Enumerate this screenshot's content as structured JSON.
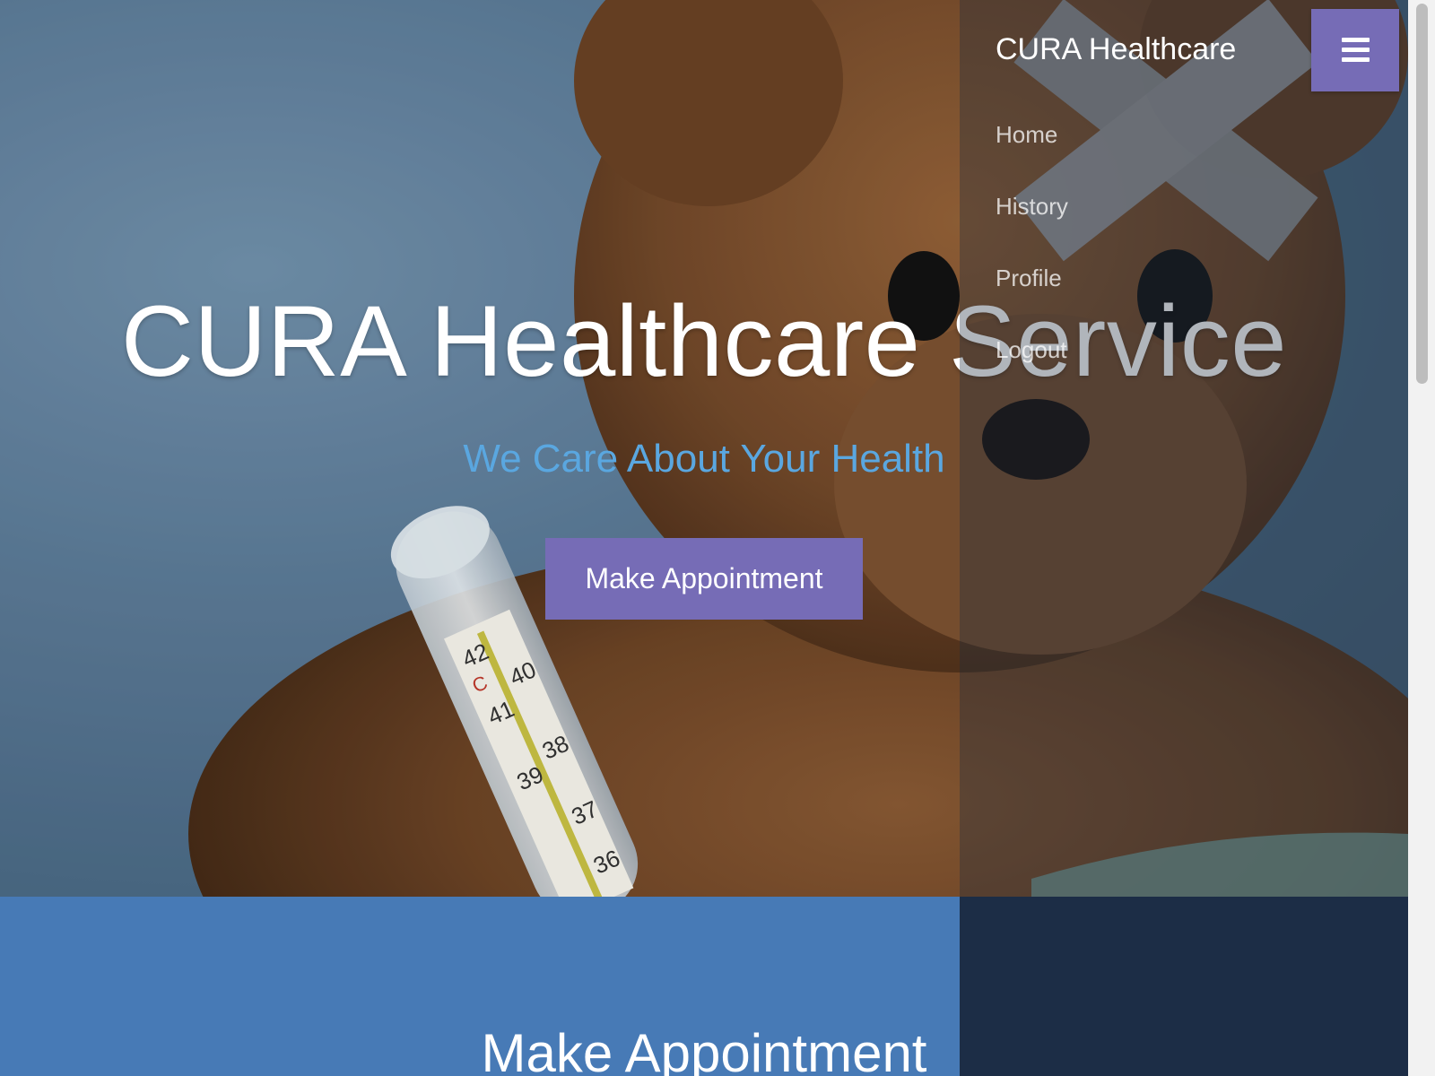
{
  "hero": {
    "title": "CURA Healthcare Service",
    "subtitle": "We Care About Your Health",
    "cta_label": "Make Appointment"
  },
  "appointment": {
    "title": "Make Appointment"
  },
  "sidebar": {
    "brand": "CURA Healthcare",
    "items": [
      {
        "label": "Home"
      },
      {
        "label": "History"
      },
      {
        "label": "Profile"
      },
      {
        "label": "Logout"
      }
    ],
    "toggle_icon": "hamburger-menu-icon"
  },
  "thermometer": {
    "scale_labels": [
      "42",
      "41",
      "40",
      "39",
      "38",
      "37",
      "36"
    ],
    "unit": "C"
  },
  "colors": {
    "accent": "#766cb6",
    "subtitle": "#5aa7e0",
    "section_blue": "#477ab6",
    "sidebar_dark": "#1c2d46"
  }
}
